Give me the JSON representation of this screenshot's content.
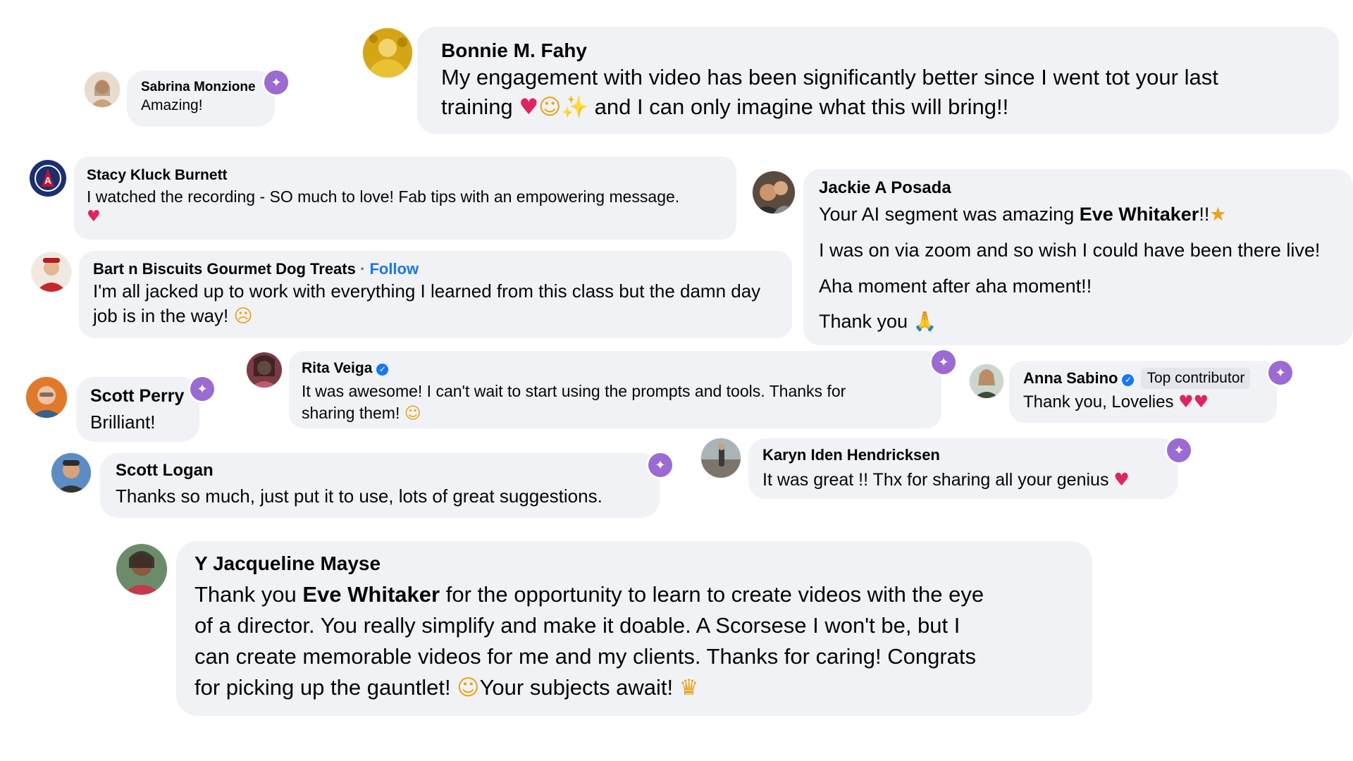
{
  "comments": [
    {
      "name": "Bonnie M. Fahy",
      "line1": "My engagement with video has been significantly better since I went tot your last",
      "line2": "training",
      "line2b": "and I can only imagine what this will bring!!",
      "emojis": [
        "heart",
        "face",
        "sparkles"
      ]
    },
    {
      "name": "Sabrina Monzione",
      "text": "Amazing!"
    },
    {
      "name": "Stacy Kluck Burnett",
      "text": "I watched the recording - SO much to love! Fab tips with an empowering message."
    },
    {
      "name": "Jackie A Posada",
      "line1a": "Your AI segment was amazing",
      "line1b": "Eve Whitaker",
      "line1c": "!!",
      "line2": "I was on via zoom and so wish I could have been there live!",
      "line3": "Aha moment after aha moment!!",
      "line4": "Thank you"
    },
    {
      "name": "Bart n Biscuits Gourmet Dog Treats",
      "separator": "·",
      "follow": "Follow",
      "line1": "I'm all jacked up to work with everything I learned from this class but the damn day",
      "line2": "job is in the way!"
    },
    {
      "name": "Rita Veiga",
      "line1": "It was awesome! I can't wait to start using the prompts and tools. Thanks for",
      "line2": "sharing them!"
    },
    {
      "name": "Scott Perry",
      "text": "Brilliant!"
    },
    {
      "name": "Anna Sabino",
      "badge": "Top contributor",
      "text": "Thank you, Lovelies"
    },
    {
      "name": "Scott Logan",
      "text": "Thanks so much, just put it to use, lots of great suggestions."
    },
    {
      "name": "Karyn Iden Hendricksen",
      "text": "It was great !! Thx for sharing all your genius"
    },
    {
      "name": "Y Jacqueline Mayse",
      "l1a": "Thank you",
      "l1b": "Eve Whitaker",
      "l1c": "for the opportunity to learn to create videos with the eye",
      "l2": "of a director. You really simplify and make it doable. A Scorsese I won't be, but I",
      "l3": "can create memorable videos for me and my clients. Thanks for caring! Congrats",
      "l4a": "for picking up the gauntlet!",
      "l4b": "Your subjects await!"
    }
  ],
  "colors": {
    "bubble": "#f0f2f5",
    "reaction": "#9b6bd3",
    "verified": "#1877f2",
    "follow": "#1877f2"
  }
}
